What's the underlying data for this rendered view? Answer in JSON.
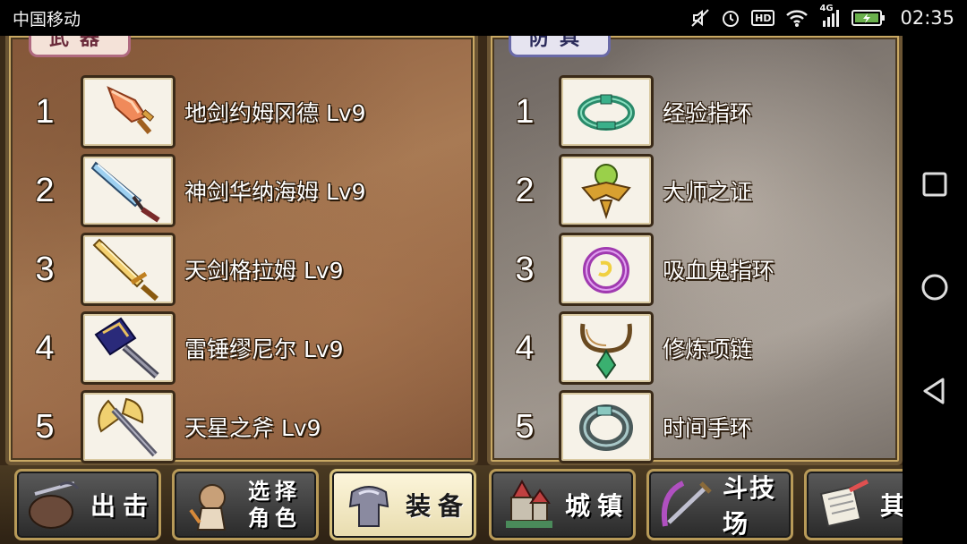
{
  "status_bar": {
    "carrier": "中国移动",
    "icons": [
      "mute-icon",
      "alarm-icon",
      "hd-icon",
      "wifi-icon",
      "signal-icon",
      "battery-icon"
    ],
    "hd_label": "HD",
    "network_label": "4G",
    "time": "02:35"
  },
  "weapons": {
    "tab_label": "武器",
    "items": [
      {
        "num": "1",
        "name": "地剑约姆冈德 Lv9",
        "icon": "dagger-icon"
      },
      {
        "num": "2",
        "name": "神剑华纳海姆 Lv9",
        "icon": "sword-icon"
      },
      {
        "num": "3",
        "name": "天剑格拉姆 Lv9",
        "icon": "golden-sword-icon"
      },
      {
        "num": "4",
        "name": "雷锤缪尼尔 Lv9",
        "icon": "hammer-icon"
      },
      {
        "num": "5",
        "name": "天星之斧 Lv9",
        "icon": "axe-icon"
      }
    ]
  },
  "armor": {
    "tab_label": "防具",
    "items": [
      {
        "num": "1",
        "name": "经验指环",
        "icon": "ring-icon"
      },
      {
        "num": "2",
        "name": "大师之证",
        "icon": "emblem-icon"
      },
      {
        "num": "3",
        "name": "吸血鬼指环",
        "icon": "vampire-ring-icon"
      },
      {
        "num": "4",
        "name": "修炼项链",
        "icon": "necklace-icon"
      },
      {
        "num": "5",
        "name": "时间手环",
        "icon": "bracelet-icon"
      }
    ]
  },
  "menu": {
    "buttons": [
      {
        "label": "出击",
        "icon": "sortie-icon",
        "active": false
      },
      {
        "label": "选择\n角色",
        "icon": "character-icon",
        "active": false
      },
      {
        "label": "装备",
        "icon": "armor-icon",
        "active": true
      },
      {
        "label": "城镇",
        "icon": "castle-icon",
        "active": false
      },
      {
        "label": "斗技场",
        "icon": "arena-icon",
        "active": false
      },
      {
        "label": "其",
        "icon": "scroll-icon",
        "active": false
      }
    ]
  },
  "colors": {
    "weapons_tab_border": "#b06a80",
    "armor_tab_border": "#6a6aa8",
    "button_border": "#b89a58",
    "active_button": "#f4ecc8"
  }
}
